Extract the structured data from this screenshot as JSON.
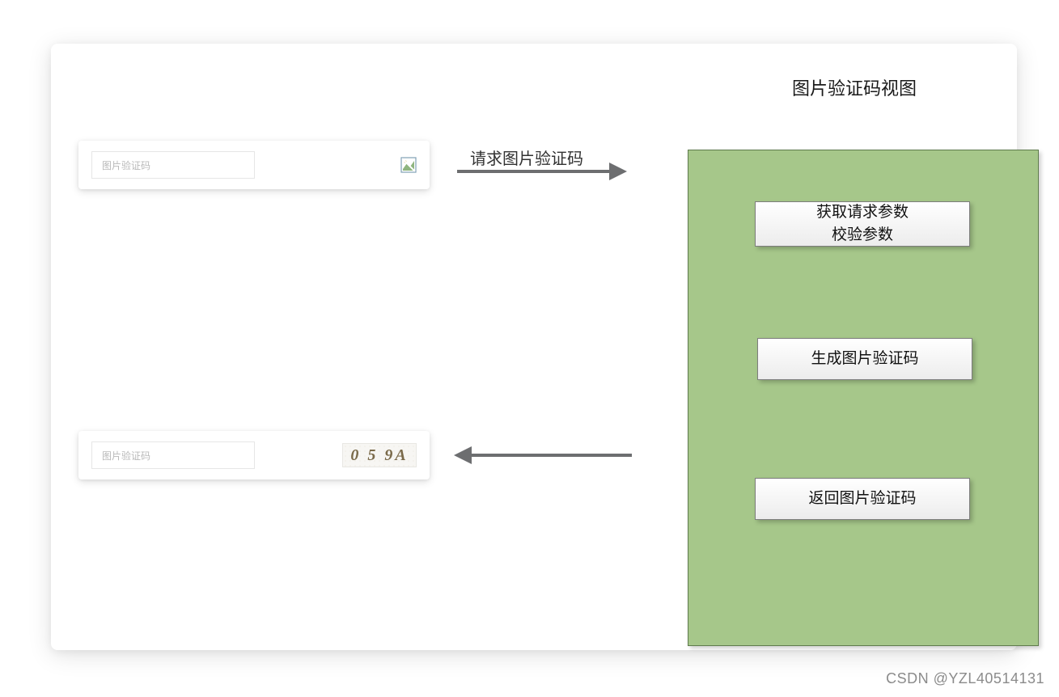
{
  "diagram": {
    "view_title": "图片验证码视图",
    "left_cards": {
      "top": {
        "placeholder": "图片验证码"
      },
      "bottom": {
        "placeholder": "图片验证码",
        "captcha_text": "0 5 9A"
      }
    },
    "arrows": {
      "request_label": "请求图片验证码",
      "response_label": ""
    },
    "steps": {
      "step1_line1": "获取请求参数",
      "step1_line2": "校验参数",
      "step2": "生成图片验证码",
      "step3": "返回图片验证码"
    }
  },
  "watermark": "CSDN @YZL40514131"
}
